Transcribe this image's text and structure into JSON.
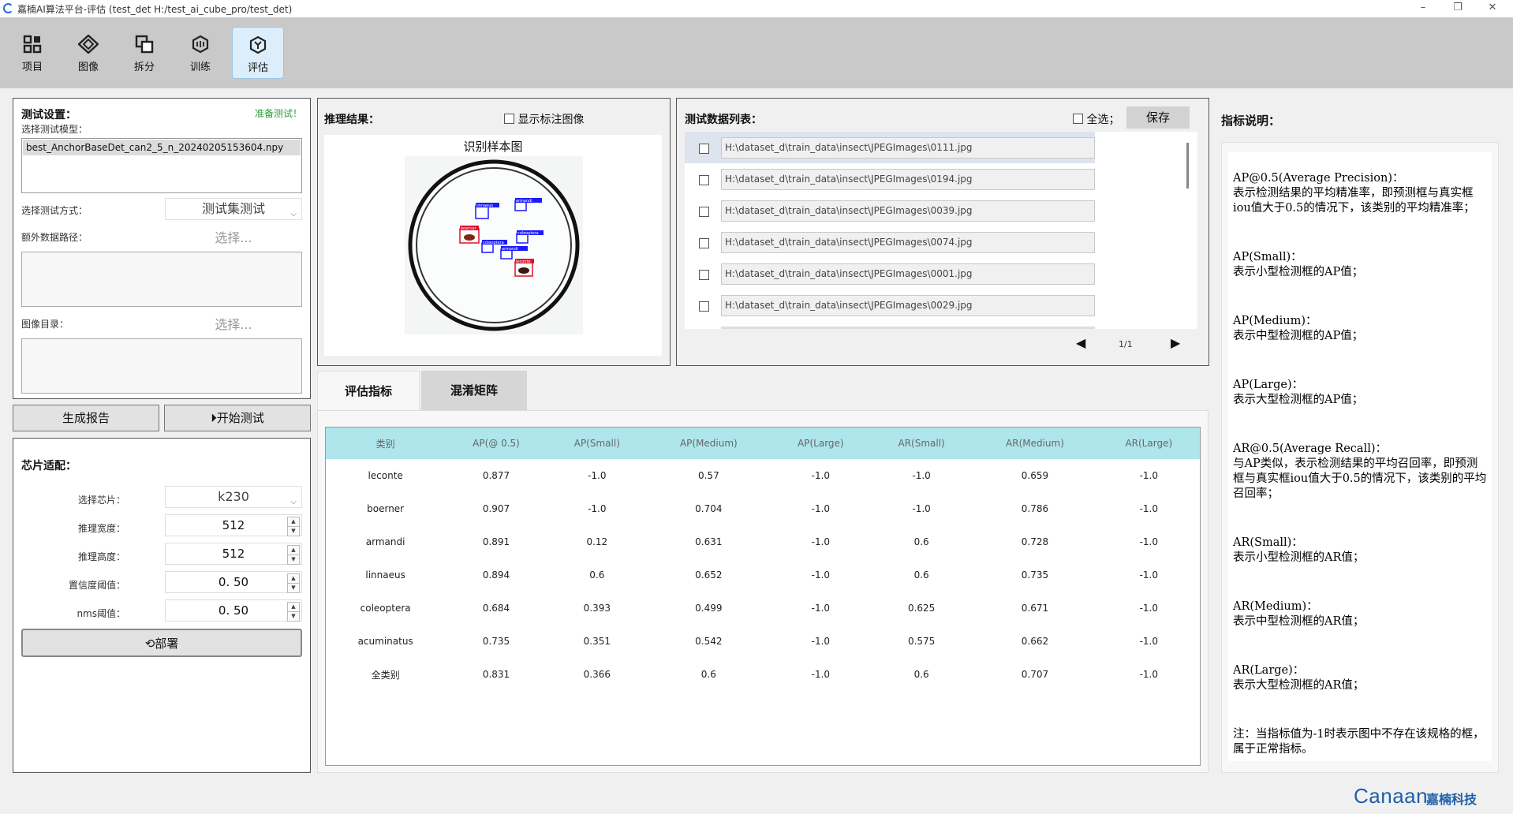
{
  "window": {
    "title": "嘉楠AI算法平台-评估 (test_det  H:/test_ai_cube_pro/test_det)"
  },
  "toolbar": {
    "items": [
      {
        "label": "项目",
        "icon": "project-icon"
      },
      {
        "label": "图像",
        "icon": "image-icon"
      },
      {
        "label": "拆分",
        "icon": "split-icon"
      },
      {
        "label": "训练",
        "icon": "train-icon"
      },
      {
        "label": "评估",
        "icon": "evaluate-icon",
        "active": true
      }
    ]
  },
  "test_settings": {
    "title": "测试设置：",
    "status": "准备测试！",
    "model_label": "选择测试模型：",
    "model_value": "best_AnchorBaseDet_can2_5_n_20240205153604.npy",
    "method_label": "选择测试方式：",
    "method_value": "测试集测试",
    "extra_path_label": "额外数据路径：",
    "extra_path_placeholder": "选择...",
    "image_dir_label": "图像目录：",
    "image_dir_placeholder": "选择..."
  },
  "buttons": {
    "report": "生成报告",
    "start": "开始测试",
    "deploy": "部署",
    "save": "保存"
  },
  "chip": {
    "title": "芯片适配：",
    "chip_label": "选择芯片：",
    "chip_value": "k230",
    "width_label": "推理宽度：",
    "width_value": "512",
    "height_label": "推理高度：",
    "height_value": "512",
    "conf_label": "置信度阈值：",
    "conf_value": "0. 50",
    "nms_label": "nms阈值：",
    "nms_value": "0. 50"
  },
  "inference": {
    "title": "推理结果：",
    "show_label": "显示标注图像",
    "sample_title": "识别样本图",
    "detections": [
      {
        "label": "linnaeus",
        "color": "#1a1aff"
      },
      {
        "label": "armandi",
        "color": "#1a1aff"
      },
      {
        "label": "boerner",
        "color": "#e0102a"
      },
      {
        "label": "coleoptera",
        "color": "#1a1aff"
      },
      {
        "label": "coleoptera",
        "color": "#1a1aff"
      },
      {
        "label": "armandi",
        "color": "#1a1aff"
      },
      {
        "label": "leconte",
        "color": "#e0102a"
      }
    ]
  },
  "data_list": {
    "title": "测试数据列表：",
    "select_all": "全选；",
    "rows": [
      "H:\\dataset_d\\train_data\\insect\\JPEGImages\\0111.jpg",
      "H:\\dataset_d\\train_data\\insect\\JPEGImages\\0194.jpg",
      "H:\\dataset_d\\train_data\\insect\\JPEGImages\\0039.jpg",
      "H:\\dataset_d\\train_data\\insect\\JPEGImages\\0074.jpg",
      "H:\\dataset_d\\train_data\\insect\\JPEGImages\\0001.jpg",
      "H:\\dataset_d\\train_data\\insect\\JPEGImages\\0029.jpg"
    ],
    "page": "1/1"
  },
  "tabs": [
    "评估指标",
    "混淆矩阵"
  ],
  "metrics": {
    "headers": [
      "类别",
      "AP(@ 0.5)",
      "AP(Small)",
      "AP(Medium)",
      "AP(Large)",
      "AR(Small)",
      "AR(Medium)",
      "AR(Large)"
    ],
    "rows": [
      [
        "leconte",
        "0.877",
        "-1.0",
        "0.57",
        "-1.0",
        "-1.0",
        "0.659",
        "-1.0"
      ],
      [
        "boerner",
        "0.907",
        "-1.0",
        "0.704",
        "-1.0",
        "-1.0",
        "0.786",
        "-1.0"
      ],
      [
        "armandi",
        "0.891",
        "0.12",
        "0.631",
        "-1.0",
        "0.6",
        "0.728",
        "-1.0"
      ],
      [
        "linnaeus",
        "0.894",
        "0.6",
        "0.652",
        "-1.0",
        "0.6",
        "0.735",
        "-1.0"
      ],
      [
        "coleoptera",
        "0.684",
        "0.393",
        "0.499",
        "-1.0",
        "0.625",
        "0.671",
        "-1.0"
      ],
      [
        "acuminatus",
        "0.735",
        "0.351",
        "0.542",
        "-1.0",
        "0.575",
        "0.662",
        "-1.0"
      ],
      [
        "全类别",
        "0.831",
        "0.366",
        "0.6",
        "-1.0",
        "0.6",
        "0.707",
        "-1.0"
      ]
    ]
  },
  "explanation": {
    "title": "指标说明：",
    "paragraphs": [
      [
        "AP@0.5(Average Precision)：",
        "表示检测结果的平均精准率，即预测框与真实框iou值大于0.5的情况下，该类别的平均精准率；"
      ],
      [
        "AP(Small)：",
        "表示小型检测框的AP值；"
      ],
      [
        "AP(Medium)：",
        "表示中型检测框的AP值；"
      ],
      [
        "AP(Large)：",
        "表示大型检测框的AP值；"
      ],
      [
        "AR@0.5(Average Recall)：",
        "与AP类似，表示检测结果的平均召回率，即预测框与真实框iou值大于0.5的情况下，该类别的平均召回率；"
      ],
      [
        "AR(Small)：",
        "表示小型检测框的AR值；"
      ],
      [
        "AR(Medium)：",
        "表示中型检测框的AR值；"
      ],
      [
        "AR(Large)：",
        "表示大型检测框的AR值；"
      ],
      [
        "注：当指标值为-1时表示图中不存在该规格的框，属于正常指标。"
      ]
    ]
  },
  "brand": {
    "logo": "Canaan",
    "name": "嘉楠科技",
    "color": "#1f5fa8"
  }
}
